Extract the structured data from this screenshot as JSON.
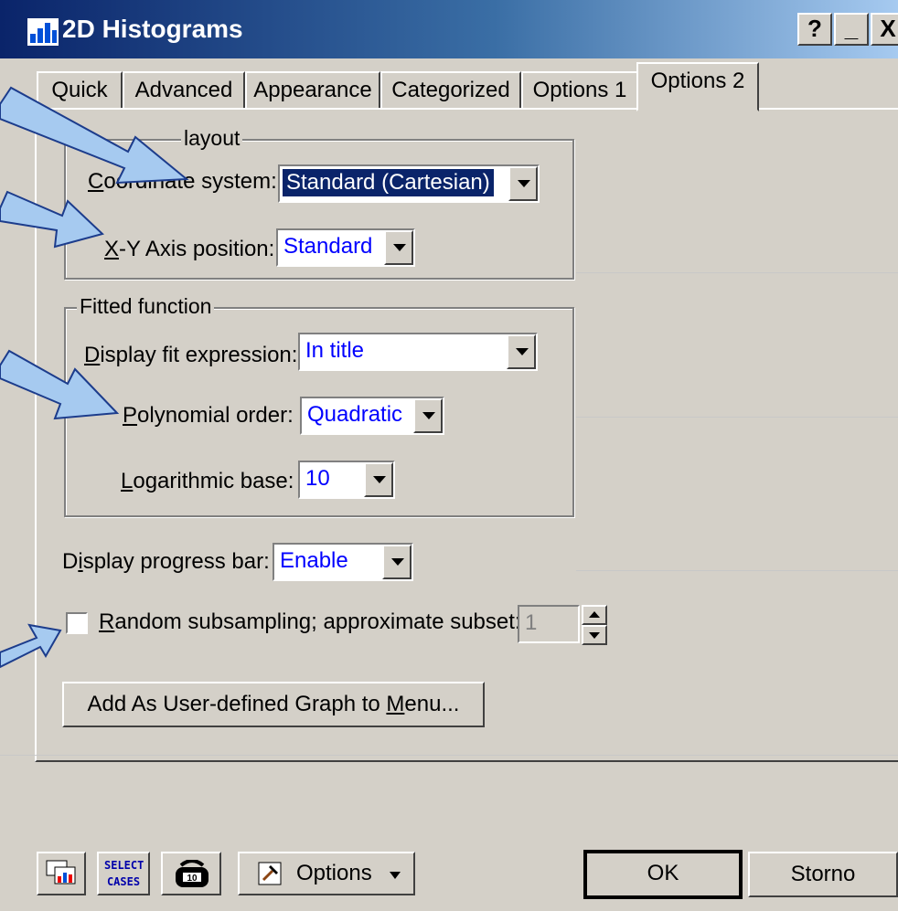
{
  "window": {
    "title": "2D Histograms",
    "caption_buttons": [
      "?",
      "_",
      "X"
    ]
  },
  "tabs": [
    "Quick",
    "Advanced",
    "Appearance",
    "Categorized",
    "Options 1",
    "Options 2"
  ],
  "active_tab": "Options 2",
  "graph_layout": {
    "legend": "Graph layout",
    "legend_visible": "layout",
    "coordinate_system_label": "Coordinate system:",
    "coordinate_system_value": "Standard (Cartesian)",
    "axis_position_label": "X-Y Axis position:",
    "axis_position_value": "Standard"
  },
  "fitted_function": {
    "legend": "Fitted function",
    "display_fit_label": "Display fit expression:",
    "display_fit_value": "In title",
    "polynomial_label": "Polynomial order:",
    "polynomial_value": "Quadratic",
    "log_base_label": "Logarithmic base:",
    "log_base_value": "10"
  },
  "progress_bar": {
    "label": "Display progress bar:",
    "value": "Enable"
  },
  "subsampling": {
    "label": "Random subsampling; approximate subset:",
    "checked": false,
    "value": "1"
  },
  "add_graph_button": "Add As User-defined Graph to Menu...",
  "bottom": {
    "select_cases_line1": "SELECT",
    "select_cases_line2": "CASES",
    "options_label": "Options",
    "ok_label": "OK",
    "cancel_label": "Storno"
  },
  "colors": {
    "dialog_bg": "#d4d0c8",
    "title_bar": "#0a246a",
    "value_text": "#0000ff",
    "callout_arrow": "#a6caf0"
  }
}
